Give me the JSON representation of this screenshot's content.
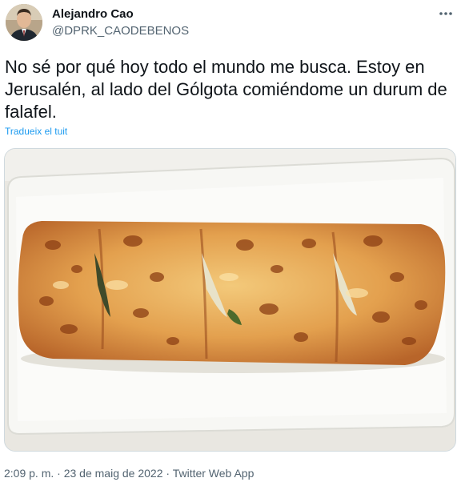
{
  "author": {
    "display_name": "Alejandro Cao",
    "handle": "@DPRK_CAODEBENOS",
    "avatar_icon": "person-avatar-icon"
  },
  "more_icon": "more-options-icon",
  "tweet": {
    "text": "No sé por qué hoy todo el mundo me busca. Estoy en Jerusalén, al lado del Gólgota comiéndome un durum de falafel.",
    "translate_label": "Tradueix el tuit"
  },
  "media": {
    "icon": "photo-durum-falafel-icon"
  },
  "meta": {
    "time": "2:09 p. m.",
    "date": "23 de maig de 2022",
    "source": "Twitter Web App",
    "separator": "·"
  },
  "colors": {
    "text": "#0f1419",
    "secondary": "#536471",
    "link": "#1d9bf0"
  }
}
